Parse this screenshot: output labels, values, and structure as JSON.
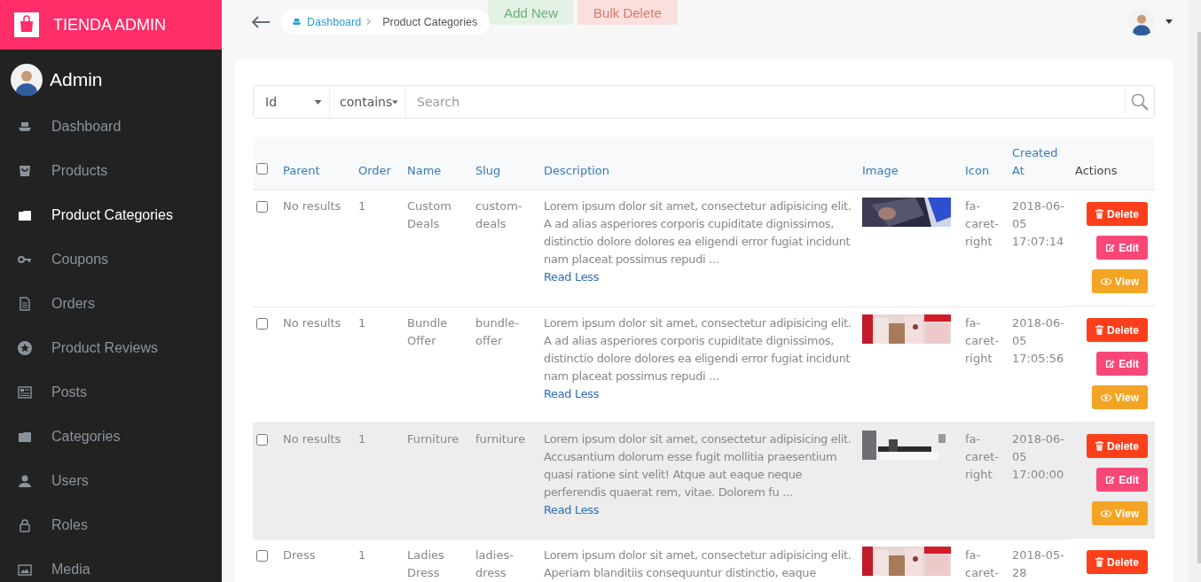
{
  "brand": {
    "title": "TIENDA ADMIN"
  },
  "user": {
    "name": "Admin"
  },
  "sidebar": {
    "items": [
      {
        "label": "Dashboard",
        "selected": false
      },
      {
        "label": "Products",
        "selected": false
      },
      {
        "label": "Product Categories",
        "selected": true
      },
      {
        "label": "Coupons",
        "selected": false
      },
      {
        "label": "Orders",
        "selected": false
      },
      {
        "label": "Product Reviews",
        "selected": false
      },
      {
        "label": "Posts",
        "selected": false
      },
      {
        "label": "Categories",
        "selected": false
      },
      {
        "label": "Users",
        "selected": false
      },
      {
        "label": "Roles",
        "selected": false
      },
      {
        "label": "Media",
        "selected": false
      }
    ]
  },
  "breadcrumb": [
    {
      "label": "Dashboard",
      "kind": "link"
    },
    {
      "label": "Product Categories",
      "kind": "current"
    }
  ],
  "toolbar": {
    "buttons": [
      {
        "label": "Add New",
        "kind": "add"
      },
      {
        "label": "Bulk Delete",
        "kind": "delete"
      }
    ]
  },
  "filter": {
    "field": "Id",
    "operator": "contains",
    "placeholder": "Search"
  },
  "table": {
    "select_all_checked": false,
    "columns": [
      "Parent",
      "Order",
      "Name",
      "Slug",
      "Description",
      "Image",
      "Icon",
      "Created At",
      "Actions"
    ],
    "rows": [
      {
        "checked": false,
        "highlighted": false,
        "parent": "No results",
        "order": "1",
        "name": "Custom Deals",
        "slug": "custom-deals",
        "description": "Lorem ipsum dolor sit amet, consectetur adipisicing elit. A ad alias asperiores corporis cupiditate dignissimos, distinctio dolore dolores ea eligendi error fugiat incidunt nam placeat possimus repudi ...",
        "toggle": "Read Less",
        "image": {
          "kind": "picture"
        },
        "icon": "fa-caret-right",
        "created": "2018-06-05 17:07:14",
        "actions": [
          {
            "label": "Delete",
            "kind": "delete"
          },
          {
            "label": "Edit",
            "kind": "edit"
          },
          {
            "label": "View",
            "kind": "view"
          }
        ]
      },
      {
        "checked": false,
        "highlighted": false,
        "parent": "No results",
        "order": "1",
        "name": "Bundle Offer",
        "slug": "bundle-offer",
        "description": "Lorem ipsum dolor sit amet, consectetur adipisicing elit. A ad alias asperiores corporis cupiditate dignissimos, distinctio dolore dolores ea eligendi error fugiat incidunt nam placeat possimus repudi ...",
        "toggle": "Read Less",
        "image": {
          "kind": "picture"
        },
        "icon": "fa-caret-right",
        "created": "2018-06-05 17:05:56",
        "actions": [
          {
            "label": "Delete",
            "kind": "delete"
          },
          {
            "label": "Edit",
            "kind": "edit"
          },
          {
            "label": "View",
            "kind": "view"
          }
        ]
      },
      {
        "checked": false,
        "highlighted": true,
        "parent": "No results",
        "order": "1",
        "name": "Furniture",
        "slug": "furniture",
        "description": "Lorem ipsum dolor sit amet, consectetur adipisicing elit. Accusantium dolorum esse fugit mollitia praesentium quasi ratione sint velit! Atque aut eaque neque perferendis quaerat rem, vitae. Dolorem fu ...",
        "toggle": "Read Less",
        "image": {
          "kind": "picture"
        },
        "icon": "fa-caret-right",
        "created": "2018-06-05 17:00:00",
        "actions": [
          {
            "label": "Delete",
            "kind": "delete"
          },
          {
            "label": "Edit",
            "kind": "edit"
          },
          {
            "label": "View",
            "kind": "view"
          }
        ]
      },
      {
        "checked": false,
        "highlighted": false,
        "parent": "Dress",
        "order": "1",
        "name": "Ladies Dress",
        "slug": "ladies-dress",
        "description": "Lorem ipsum dolor sit amet, consectetur adipisicing elit. Aperiam blanditiis consequuntur distinctio, eaque",
        "image": {
          "kind": "picture"
        },
        "icon": "fa-caret-",
        "created": "2018-05-28",
        "actions": [
          {
            "label": "Delete",
            "kind": "delete"
          }
        ]
      }
    ]
  }
}
